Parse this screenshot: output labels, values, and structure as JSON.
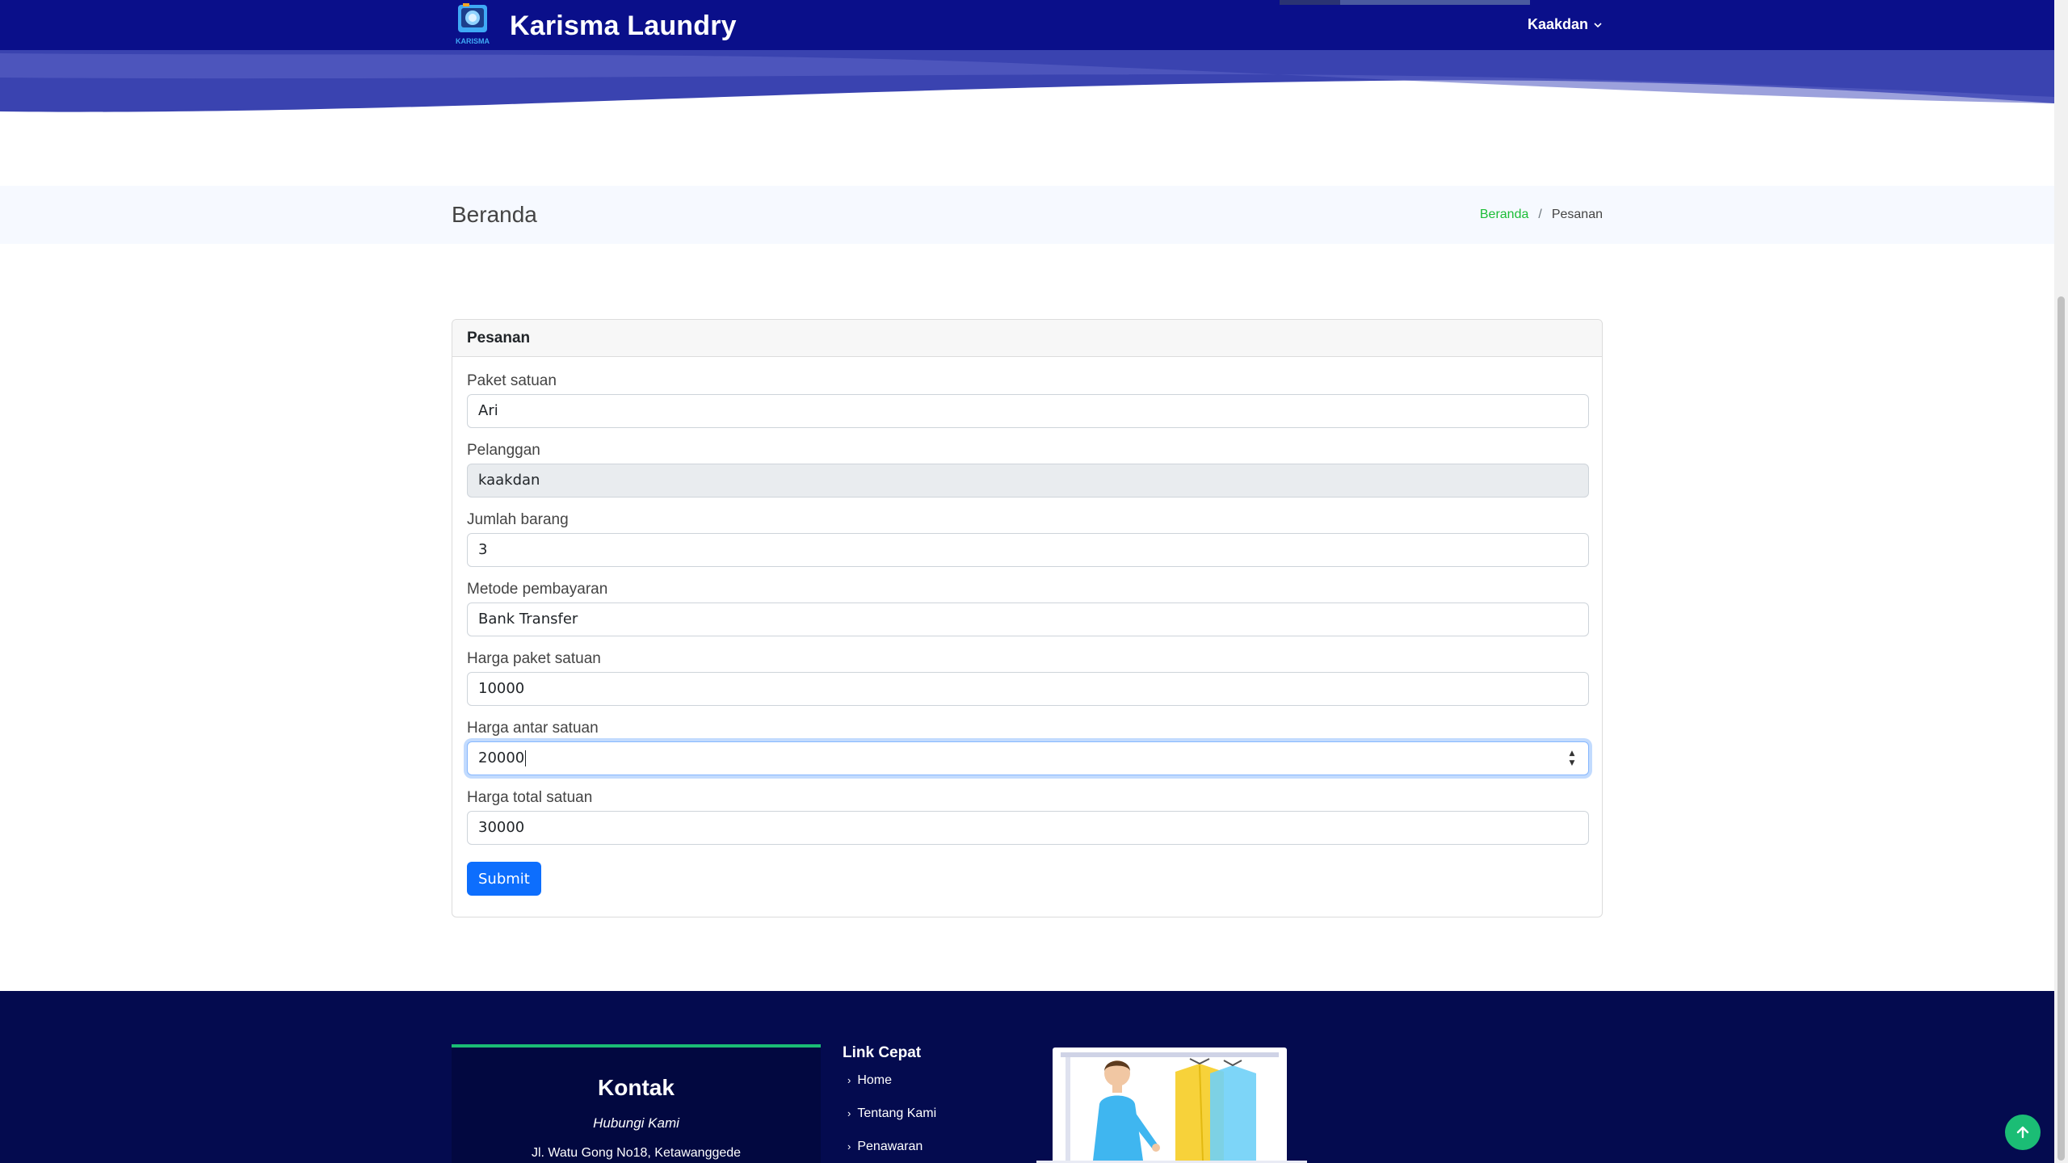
{
  "nav": {
    "brand": "Karisma Laundry",
    "logo_text": "KARISMA",
    "user_menu": "Kaakdan",
    "user_menu_icon": "chevron-down-icon",
    "colors": {
      "header_bg": "#0a0f8a",
      "wave": "#3a43b0"
    }
  },
  "page": {
    "heading": "Beranda",
    "breadcrumb": [
      {
        "label": "Beranda",
        "link": true
      },
      {
        "label": "Pesanan",
        "link": false
      }
    ],
    "breadcrumb_separator": "/"
  },
  "form": {
    "title": "Pesanan",
    "fields": [
      {
        "label": "Paket satuan",
        "value": "Ari",
        "readonly": false
      },
      {
        "label": "Pelanggan",
        "value": "kaakdan",
        "readonly": true
      },
      {
        "label": "Jumlah barang",
        "value": "3",
        "readonly": false
      },
      {
        "label": "Metode pembayaran",
        "value": "Bank Transfer",
        "readonly": false
      },
      {
        "label": "Harga paket satuan",
        "value": "10000",
        "readonly": false
      },
      {
        "label": "Harga antar satuan",
        "value": "20000",
        "readonly": false,
        "focused": true,
        "type": "number"
      },
      {
        "label": "Harga total satuan",
        "value": "30000",
        "readonly": false
      }
    ],
    "submit_label": "Submit",
    "colors": {
      "primary": "#0d6efd",
      "focus_ring": "#86b7fe"
    }
  },
  "footer": {
    "contact": {
      "title": "Kontak",
      "subtitle": "Hubungi Kami",
      "address": "Jl. Watu Gong No18, Ketawanggede"
    },
    "quick_links": {
      "title": "Link Cepat",
      "items": [
        "Home",
        "Tentang Kami",
        "Penawaran"
      ]
    },
    "colors": {
      "bg": "#040b4f",
      "accent": "#1bbd75"
    }
  },
  "back_to_top_icon": "arrow-up-icon"
}
